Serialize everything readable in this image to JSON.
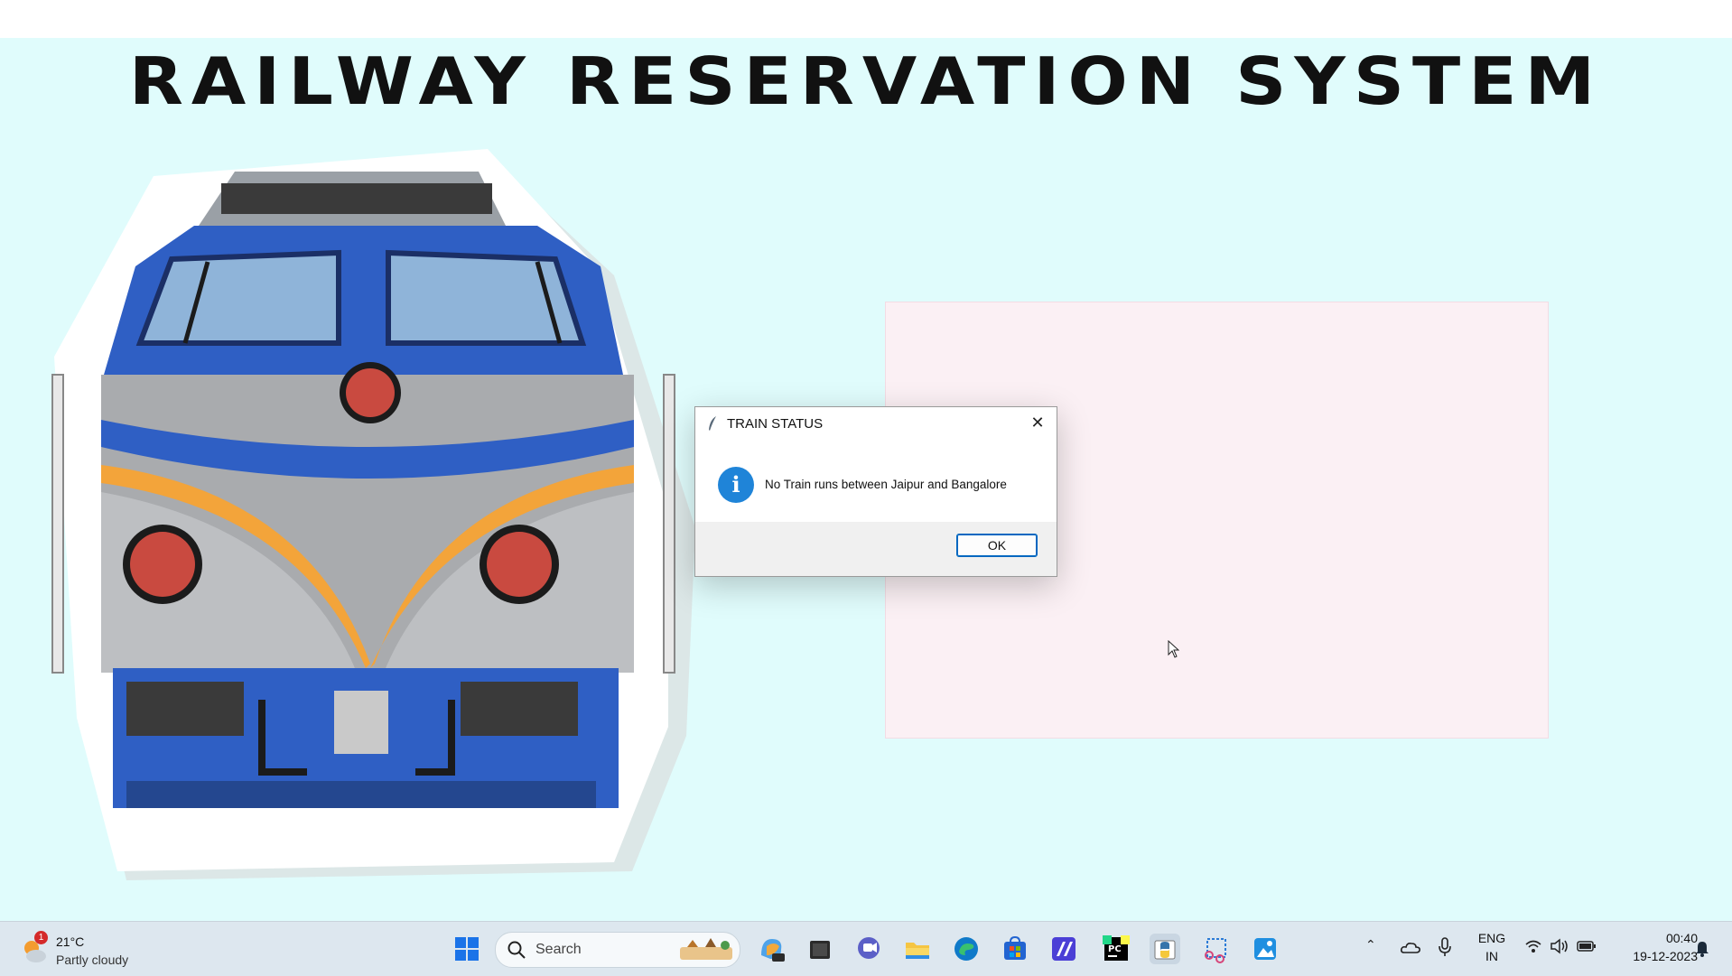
{
  "app": {
    "title": "RAILWAY RESERVATION SYSTEM"
  },
  "dialog": {
    "title": "TRAIN STATUS",
    "message": "No Train runs between Jaipur and Bangalore",
    "close_glyph": "✕",
    "info_glyph": "i",
    "ok_label": "OK"
  },
  "taskbar": {
    "weather": {
      "badge": "1",
      "temperature": "21°C",
      "condition": "Partly cloudy"
    },
    "search": {
      "label": "Search"
    },
    "pinned_icons": [
      "copilot-icon",
      "file-manager-icon",
      "teams-chat-icon",
      "file-explorer-icon",
      "edge-icon",
      "microsoft-store-icon",
      "app-icon",
      "pycharm-icon",
      "python-idle-icon",
      "snipping-tool-icon",
      "photos-icon"
    ],
    "tray": {
      "language": "ENG",
      "region": "IN",
      "time": "00:40",
      "date": "19-12-2023"
    }
  },
  "colors": {
    "background": "#e0fcfc",
    "panel": "#fbf0f4",
    "accent": "#0067c0",
    "info": "#1f84d8"
  }
}
